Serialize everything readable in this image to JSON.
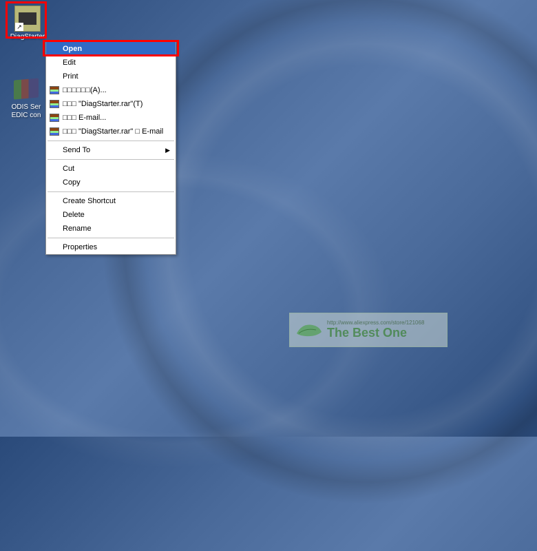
{
  "desktop": {
    "icons": {
      "diagstarter": {
        "label": "DiagStarter"
      },
      "odis": {
        "label": "ODIS Ser EDIC con"
      }
    }
  },
  "contextMenu": {
    "items": [
      {
        "label": "Open",
        "highlighted": true
      },
      {
        "label": "Edit"
      },
      {
        "label": "Print"
      },
      {
        "label": "□□□□□□(A)...",
        "icon": "rar"
      },
      {
        "label": "□□□ \"DiagStarter.rar\"(T)",
        "icon": "rar"
      },
      {
        "label": "□□□ E-mail...",
        "icon": "rar"
      },
      {
        "label": "□□□ \"DiagStarter.rar\" □ E-mail",
        "icon": "rar"
      },
      {
        "separator": true
      },
      {
        "label": "Send To",
        "submenu": true
      },
      {
        "separator": true
      },
      {
        "label": "Cut"
      },
      {
        "label": "Copy"
      },
      {
        "separator": true
      },
      {
        "label": "Create Shortcut"
      },
      {
        "label": "Delete"
      },
      {
        "label": "Rename"
      },
      {
        "separator": true
      },
      {
        "label": "Properties"
      }
    ]
  },
  "watermark": {
    "url": "http://www.aliexpress.com/store/121068",
    "brand": "The Best One"
  }
}
